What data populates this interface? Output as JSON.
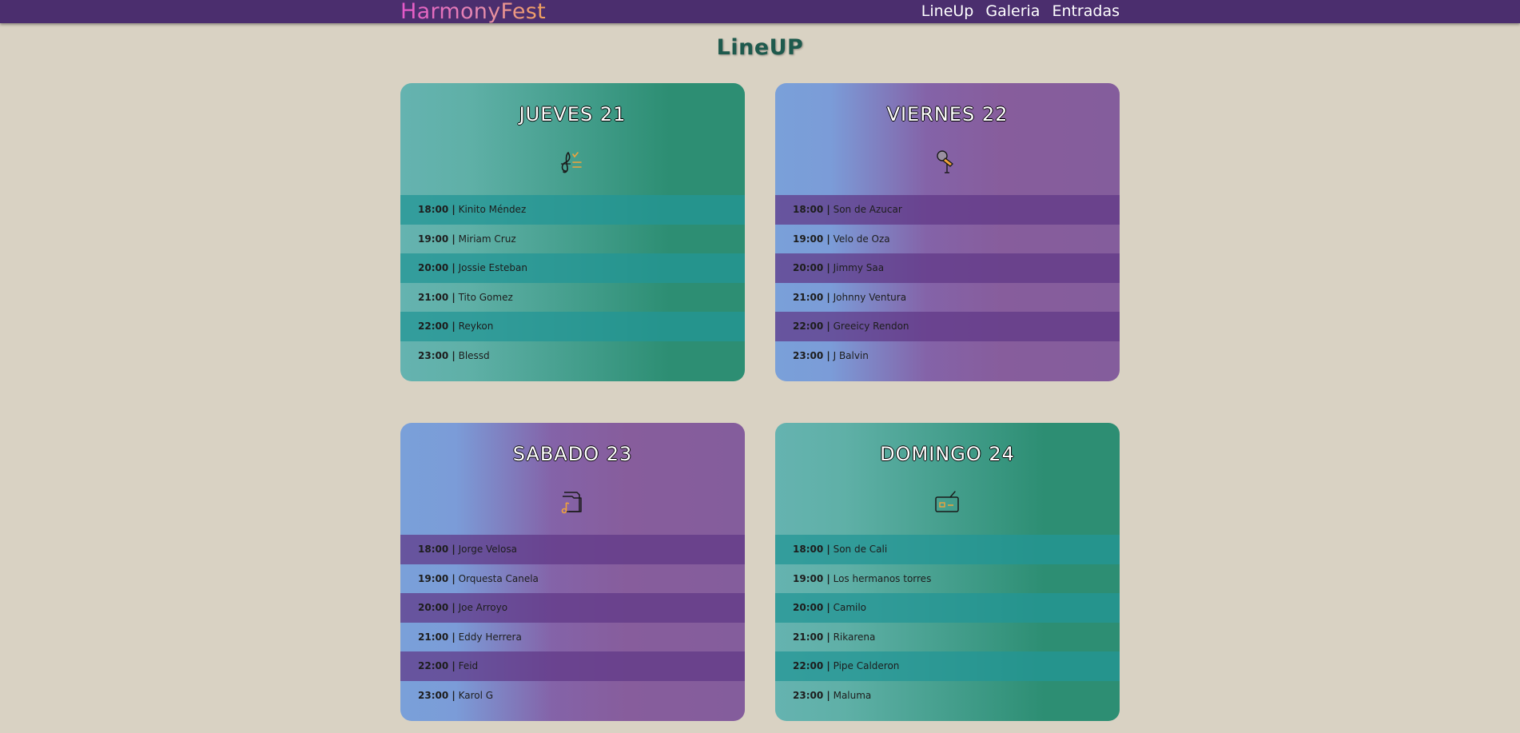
{
  "nav": {
    "brand": "HarmonyFest",
    "links": [
      "LineUp",
      "Galeria",
      "Entradas"
    ]
  },
  "title": "LineUP",
  "days": [
    {
      "day": "JUEVES 21",
      "icon": "music-list-icon",
      "rows": [
        {
          "time": "18:00 |",
          "artist": "Kinito Méndez"
        },
        {
          "time": "19:00 |",
          "artist": "Miriam Cruz"
        },
        {
          "time": "20:00 |",
          "artist": "Jossie Esteban"
        },
        {
          "time": "21:00 |",
          "artist": "Tito Gomez"
        },
        {
          "time": "22:00 |",
          "artist": "Reykon"
        },
        {
          "time": "23:00 |",
          "artist": "Blessd"
        }
      ]
    },
    {
      "day": "VIERNES 22",
      "icon": "microphone-icon",
      "rows": [
        {
          "time": "18:00 |",
          "artist": "Son de Azucar"
        },
        {
          "time": "19:00 |",
          "artist": "Velo de Oza"
        },
        {
          "time": "20:00 |",
          "artist": "Jimmy Saa"
        },
        {
          "time": "21:00 |",
          "artist": "Johnny Ventura"
        },
        {
          "time": "22:00 |",
          "artist": "Greeicy Rendon"
        },
        {
          "time": "23:00 |",
          "artist": "J Balvin"
        }
      ]
    },
    {
      "day": "SABADO 23",
      "icon": "music-folder-icon",
      "rows": [
        {
          "time": "18:00 |",
          "artist": "Jorge Velosa"
        },
        {
          "time": "19:00 |",
          "artist": "Orquesta Canela"
        },
        {
          "time": "20:00 |",
          "artist": "Joe Arroyo"
        },
        {
          "time": "21:00 |",
          "artist": "Eddy Herrera"
        },
        {
          "time": "22:00 |",
          "artist": "Feid"
        },
        {
          "time": "23:00 |",
          "artist": "Karol G"
        }
      ]
    },
    {
      "day": "DOMINGO 24",
      "icon": "radio-icon",
      "rows": [
        {
          "time": "18:00 |",
          "artist": "Son de Cali"
        },
        {
          "time": "19:00 |",
          "artist": "Los hermanos torres"
        },
        {
          "time": "20:00 |",
          "artist": "Camilo"
        },
        {
          "time": "21:00 |",
          "artist": "Rikarena"
        },
        {
          "time": "22:00 |",
          "artist": "Pipe Calderon"
        },
        {
          "time": "23:00 |",
          "artist": "Maluma"
        }
      ]
    }
  ],
  "colors": {
    "navbar": "#4b2e6e",
    "background": "#d9d2c3",
    "title": "#1e5a4d",
    "icon_accent": "#f2a33a"
  }
}
